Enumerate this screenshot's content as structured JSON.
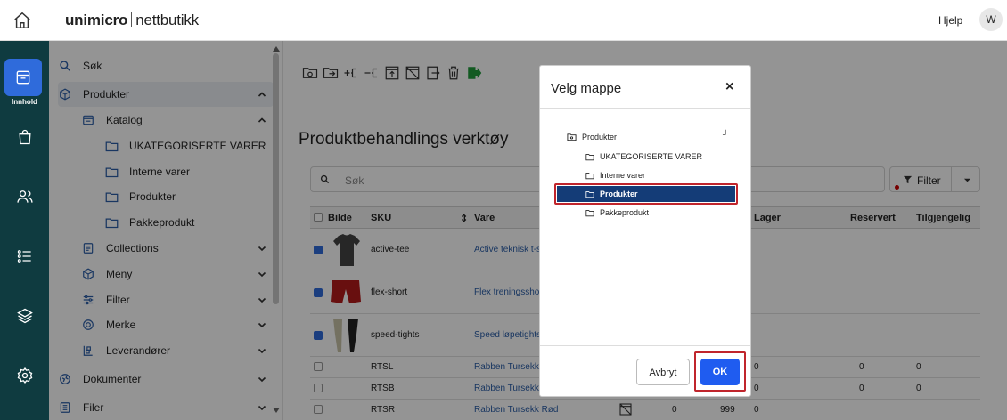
{
  "header": {
    "brand_bold": "unimicro",
    "brand_light": "nettbutikk",
    "help_label": "Hjelp",
    "avatar_initial": "W"
  },
  "rail": {
    "active_label": "Innhold"
  },
  "sidebar": {
    "items": [
      {
        "label": "Søk"
      },
      {
        "label": "Produkter"
      },
      {
        "label": "Katalog"
      },
      {
        "label": "UKATEGORISERTE VARER"
      },
      {
        "label": "Interne varer"
      },
      {
        "label": "Produkter"
      },
      {
        "label": "Pakkeprodukt"
      },
      {
        "label": "Collections"
      },
      {
        "label": "Meny"
      },
      {
        "label": "Filter"
      },
      {
        "label": "Merke"
      },
      {
        "label": "Leverandører"
      },
      {
        "label": "Dokumenter"
      },
      {
        "label": "Filer"
      }
    ]
  },
  "main": {
    "title": "Produktbehandlings verktøy",
    "search_placeholder": "Søk",
    "filter_label": "Filter",
    "columns": [
      "Bilde",
      "SKU",
      "Vare",
      "Lager",
      "Reservert",
      "Tilgjengelig"
    ],
    "rows": [
      {
        "sku": "active-tee",
        "name": "Active teknisk t-s",
        "checked": true,
        "lager": "",
        "reservert": "",
        "tilgjengelig": "",
        "extra": ""
      },
      {
        "sku": "flex-short",
        "name": "Flex treningssho",
        "checked": true,
        "lager": "",
        "reservert": "",
        "tilgjengelig": "",
        "extra": ""
      },
      {
        "sku": "speed-tights",
        "name": "Speed løpetights",
        "checked": true,
        "lager": "",
        "reservert": "",
        "tilgjengelig": "",
        "extra": ""
      },
      {
        "sku": "RTSL",
        "name": "Rabben Tursekk",
        "checked": false,
        "lager": "0",
        "reservert": "0",
        "tilgjengelig": "0",
        "extra": ""
      },
      {
        "sku": "RTSB",
        "name": "Rabben Tursekk",
        "checked": false,
        "lager": "0",
        "reservert": "0",
        "tilgjengelig": "0",
        "extra": ""
      },
      {
        "sku": "RTSR",
        "name": "Rabben Tursekk Rød",
        "checked": false,
        "lager": "0",
        "reservert": "0",
        "tilgjengelig": "0",
        "extra": "999"
      }
    ]
  },
  "dialog": {
    "title": "Velg mappe",
    "close": "×",
    "root": "Produkter",
    "folders": [
      "UKATEGORISERTE VARER",
      "Interne varer",
      "Produkter",
      "Pakkeprodukt"
    ],
    "selected_index": 2,
    "cancel_label": "Avbryt",
    "ok_label": "OK"
  },
  "colors": {
    "rail": "#0f3b40",
    "accent": "#2f6bdb",
    "ok": "#1f5cf0",
    "selected": "#143c77",
    "highlight": "#c0252c"
  }
}
